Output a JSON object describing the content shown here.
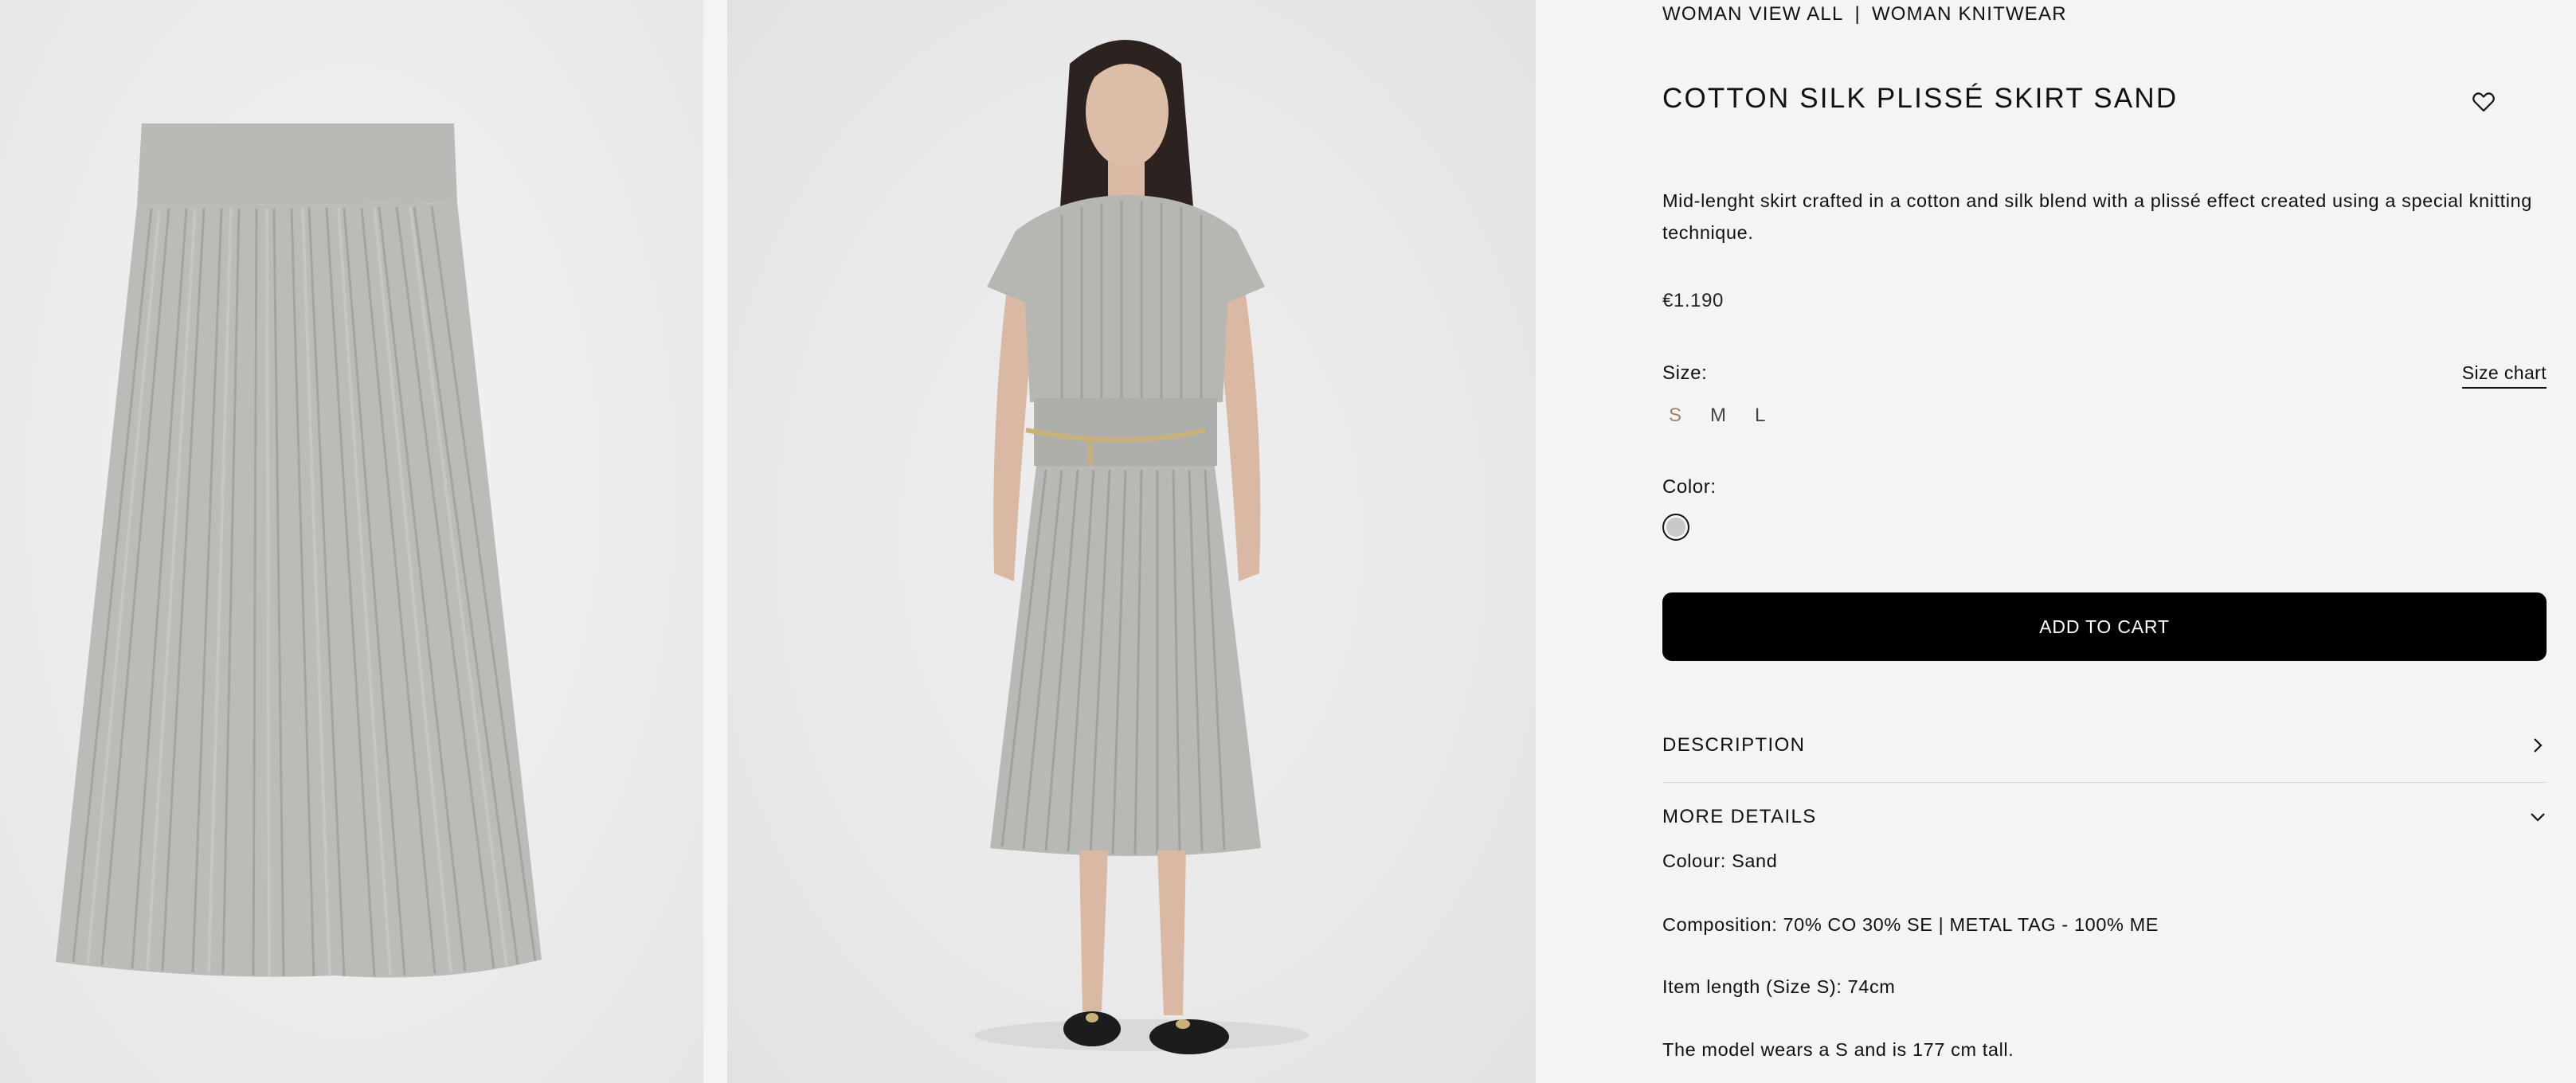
{
  "breadcrumb": {
    "items": [
      "WOMAN VIEW ALL",
      "WOMAN KNITWEAR"
    ],
    "separator": "|"
  },
  "product": {
    "title": "COTTON SILK PLISSÉ SKIRT SAND",
    "description": "Mid-lenght skirt crafted in a cotton and silk blend with a plissé effect created using a special knitting technique.",
    "price": "€1.190"
  },
  "size": {
    "label": "Size:",
    "chart_link": "Size chart",
    "options": [
      "S",
      "M",
      "L"
    ],
    "selected": "S",
    "selected_color": "#a0826a"
  },
  "color": {
    "label": "Color:",
    "swatch_color": "#c8c8c8"
  },
  "cart": {
    "button_label": "ADD TO CART",
    "button_color": "#000000"
  },
  "accordion": {
    "description_label": "DESCRIPTION",
    "more_details_label": "MORE DETAILS",
    "more_details_items": [
      "Colour: Sand",
      "Composition: 70% CO 30% SE | METAL TAG - 100% ME",
      "Item length (Size S): 74cm",
      "The model wears a S and is 177 cm tall."
    ]
  },
  "icons": {
    "wishlist": "heart-icon",
    "description_toggle": "chevron-right-icon",
    "more_details_toggle": "chevron-down-icon"
  }
}
